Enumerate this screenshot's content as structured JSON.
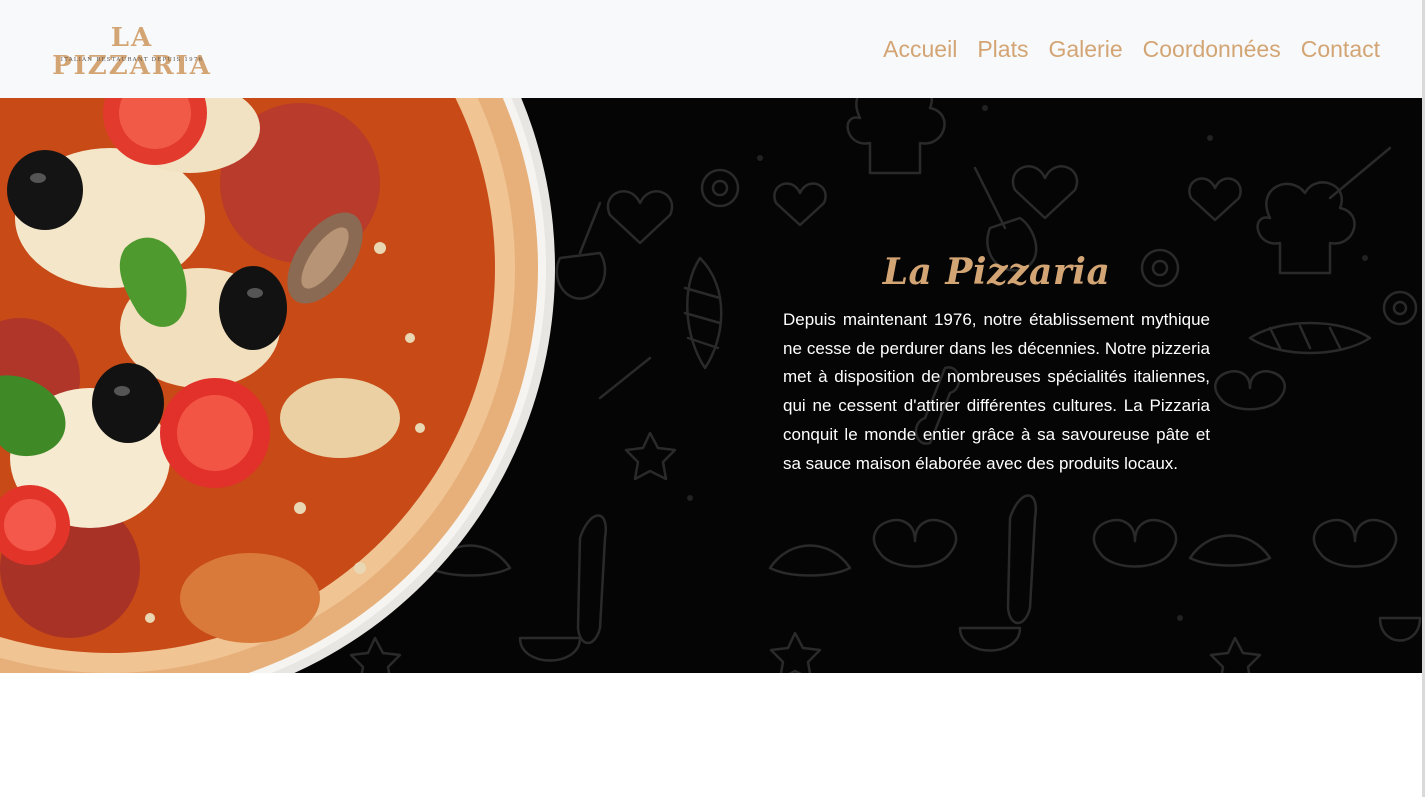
{
  "header": {
    "logo": {
      "name": "LA PIZZARIA",
      "tagline": "ITALIAN RESTAURANT DEPUIS 1976"
    },
    "nav": [
      {
        "label": "Accueil"
      },
      {
        "label": "Plats"
      },
      {
        "label": "Galerie"
      },
      {
        "label": "Coordonnées"
      },
      {
        "label": "Contact"
      }
    ]
  },
  "hero": {
    "title": "La Pizzaria",
    "paragraph": "Depuis maintenant 1976, notre établissement mythique ne cesse de perdurer dans les décennies. Notre pizzeria met à disposition de nombreuses spécialités italiennes, qui ne cessent d'attirer différentes cultures. La Pizzaria conquit le monde entier grâce à sa savoureuse pâte et sa sauce maison élaborée avec des produits locaux."
  },
  "colors": {
    "accent": "#d4a574",
    "header_bg": "#f7f9fb",
    "hero_bg": "#050505",
    "text_light": "#ffffff"
  }
}
